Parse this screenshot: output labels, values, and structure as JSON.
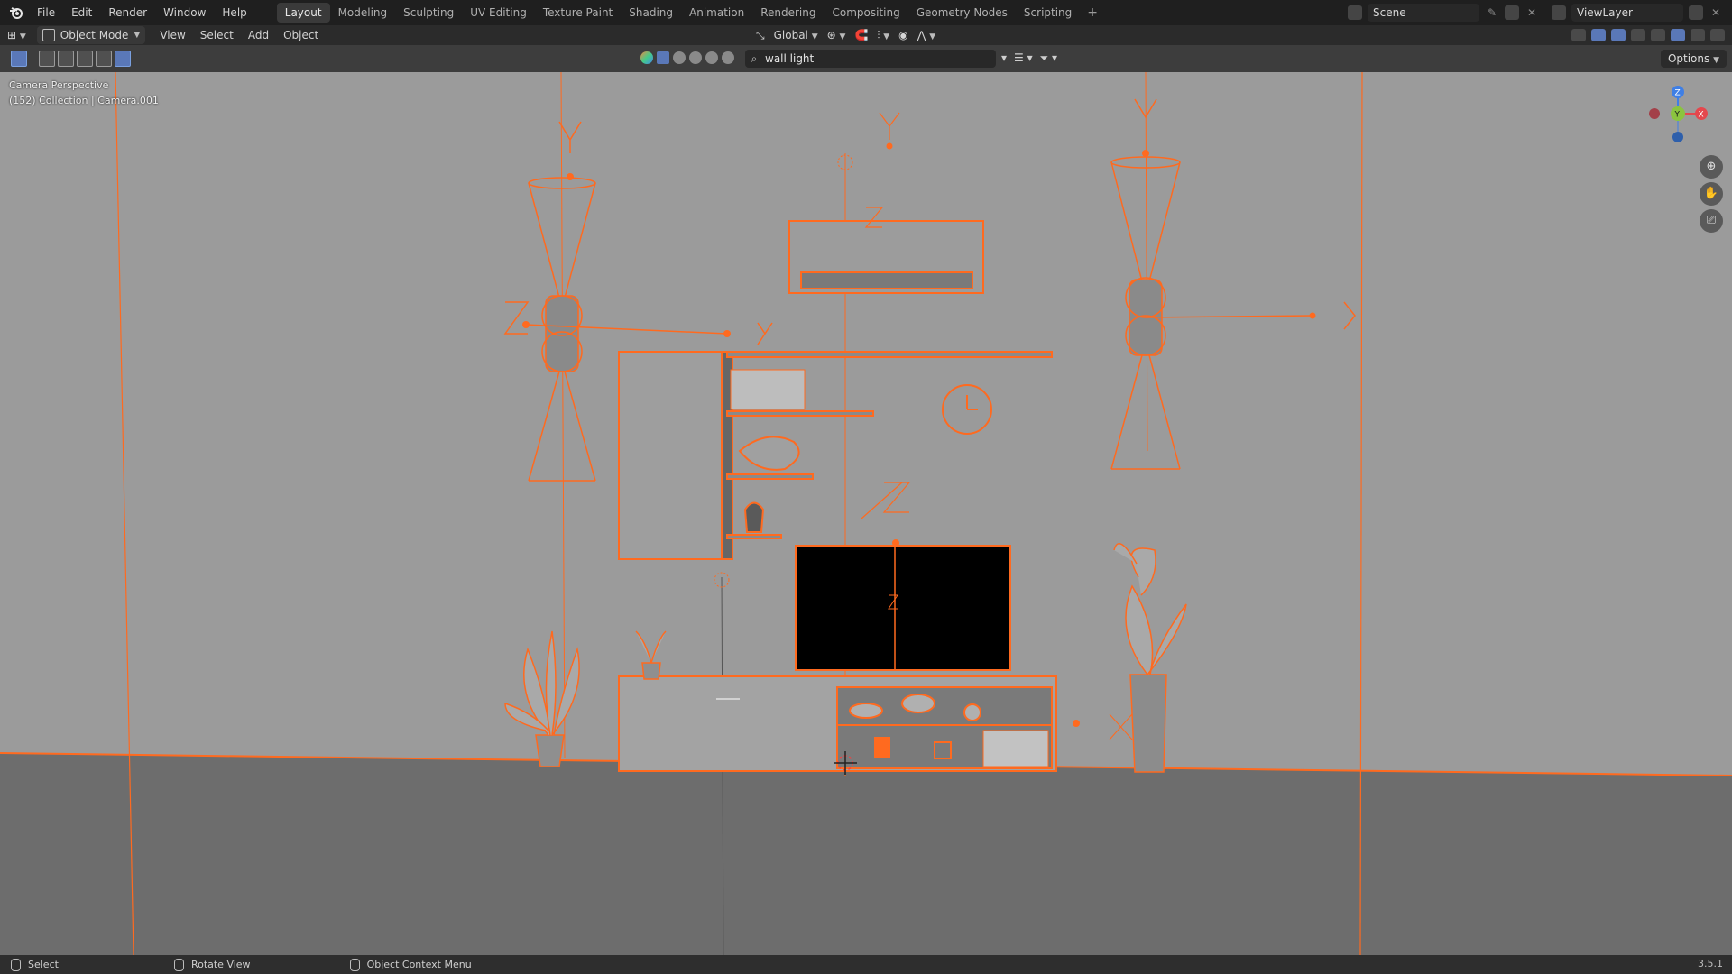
{
  "app": {
    "name": "Blender",
    "version": "3.5.1"
  },
  "menu": [
    "File",
    "Edit",
    "Render",
    "Window",
    "Help"
  ],
  "workspace_tabs": [
    {
      "label": "Layout",
      "active": true
    },
    {
      "label": "Modeling"
    },
    {
      "label": "Sculpting"
    },
    {
      "label": "UV Editing"
    },
    {
      "label": "Texture Paint"
    },
    {
      "label": "Shading"
    },
    {
      "label": "Animation"
    },
    {
      "label": "Rendering"
    },
    {
      "label": "Compositing"
    },
    {
      "label": "Geometry Nodes"
    },
    {
      "label": "Scripting"
    }
  ],
  "add_tab_symbol": "+",
  "scene": {
    "name": "Scene"
  },
  "view_layer": {
    "name": "ViewLayer"
  },
  "header": {
    "mode": "Object Mode",
    "menus": [
      "View",
      "Select",
      "Add",
      "Object"
    ],
    "transform_orientation": "Global"
  },
  "viewport_header": {
    "search_value": "wall light",
    "options_label": "Options"
  },
  "viewport": {
    "perspective_label": "Camera Perspective",
    "collection_label": "(152) Collection | Camera.001",
    "background": "#9b9b9b",
    "floor": "#6b6b6b",
    "selection_color": "#ff6a1f",
    "gizmo": {
      "x": "X",
      "y": "Y",
      "z": "Z",
      "x_color": "#e5474d",
      "y_color": "#8bc43f",
      "z_color": "#3f7fe5"
    }
  },
  "statusbar": {
    "items": [
      {
        "label": "Select",
        "icon": "mouse-left-icon"
      },
      {
        "label": "Rotate View",
        "icon": "mouse-middle-icon"
      },
      {
        "label": "Object Context Menu",
        "icon": "mouse-right-icon"
      }
    ],
    "version": "3.5.1"
  }
}
